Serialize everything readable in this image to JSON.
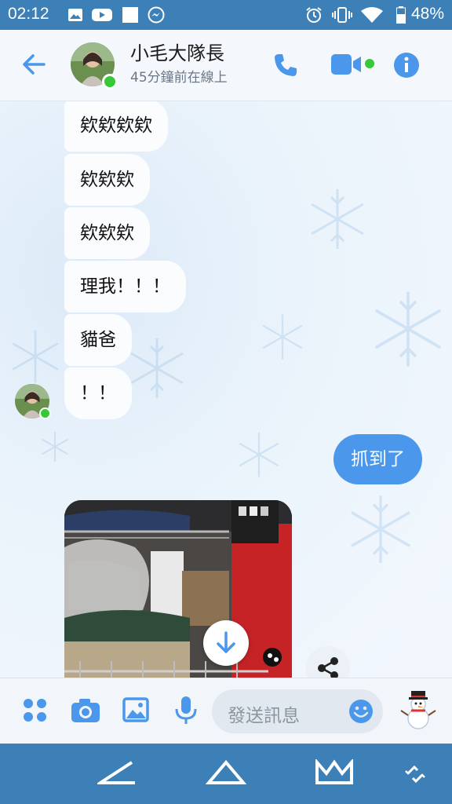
{
  "status_bar": {
    "time": "02:12",
    "battery": "48%",
    "icons": [
      "gallery-icon",
      "youtube-icon",
      "square-icon",
      "messenger-icon",
      "alarm-icon",
      "vibrate-icon",
      "wifi-icon",
      "battery-icon"
    ]
  },
  "header": {
    "contact_name": "小毛大隊長",
    "contact_status": "45分鐘前在線上",
    "accent_color": "#4a97eb",
    "online_color": "#37c837"
  },
  "messages": {
    "incoming": [
      {
        "text": "欸欸欸欸"
      },
      {
        "text": "欸欸欸"
      },
      {
        "text": "欸欸欸"
      },
      {
        "text": "理我！！！"
      },
      {
        "text": "貓爸"
      },
      {
        "text": "！！"
      }
    ],
    "outgoing": [
      {
        "text": "抓到了"
      }
    ]
  },
  "composer": {
    "placeholder": "發送訊息",
    "icons": [
      "apps-icon",
      "camera-icon",
      "gallery-icon",
      "microphone-icon",
      "emoji-icon",
      "snowman-sticker-icon"
    ]
  },
  "nav_bar": {
    "icons": [
      "back-nav-icon",
      "home-nav-icon",
      "crown-nav-icon",
      "rotate-icon"
    ]
  }
}
